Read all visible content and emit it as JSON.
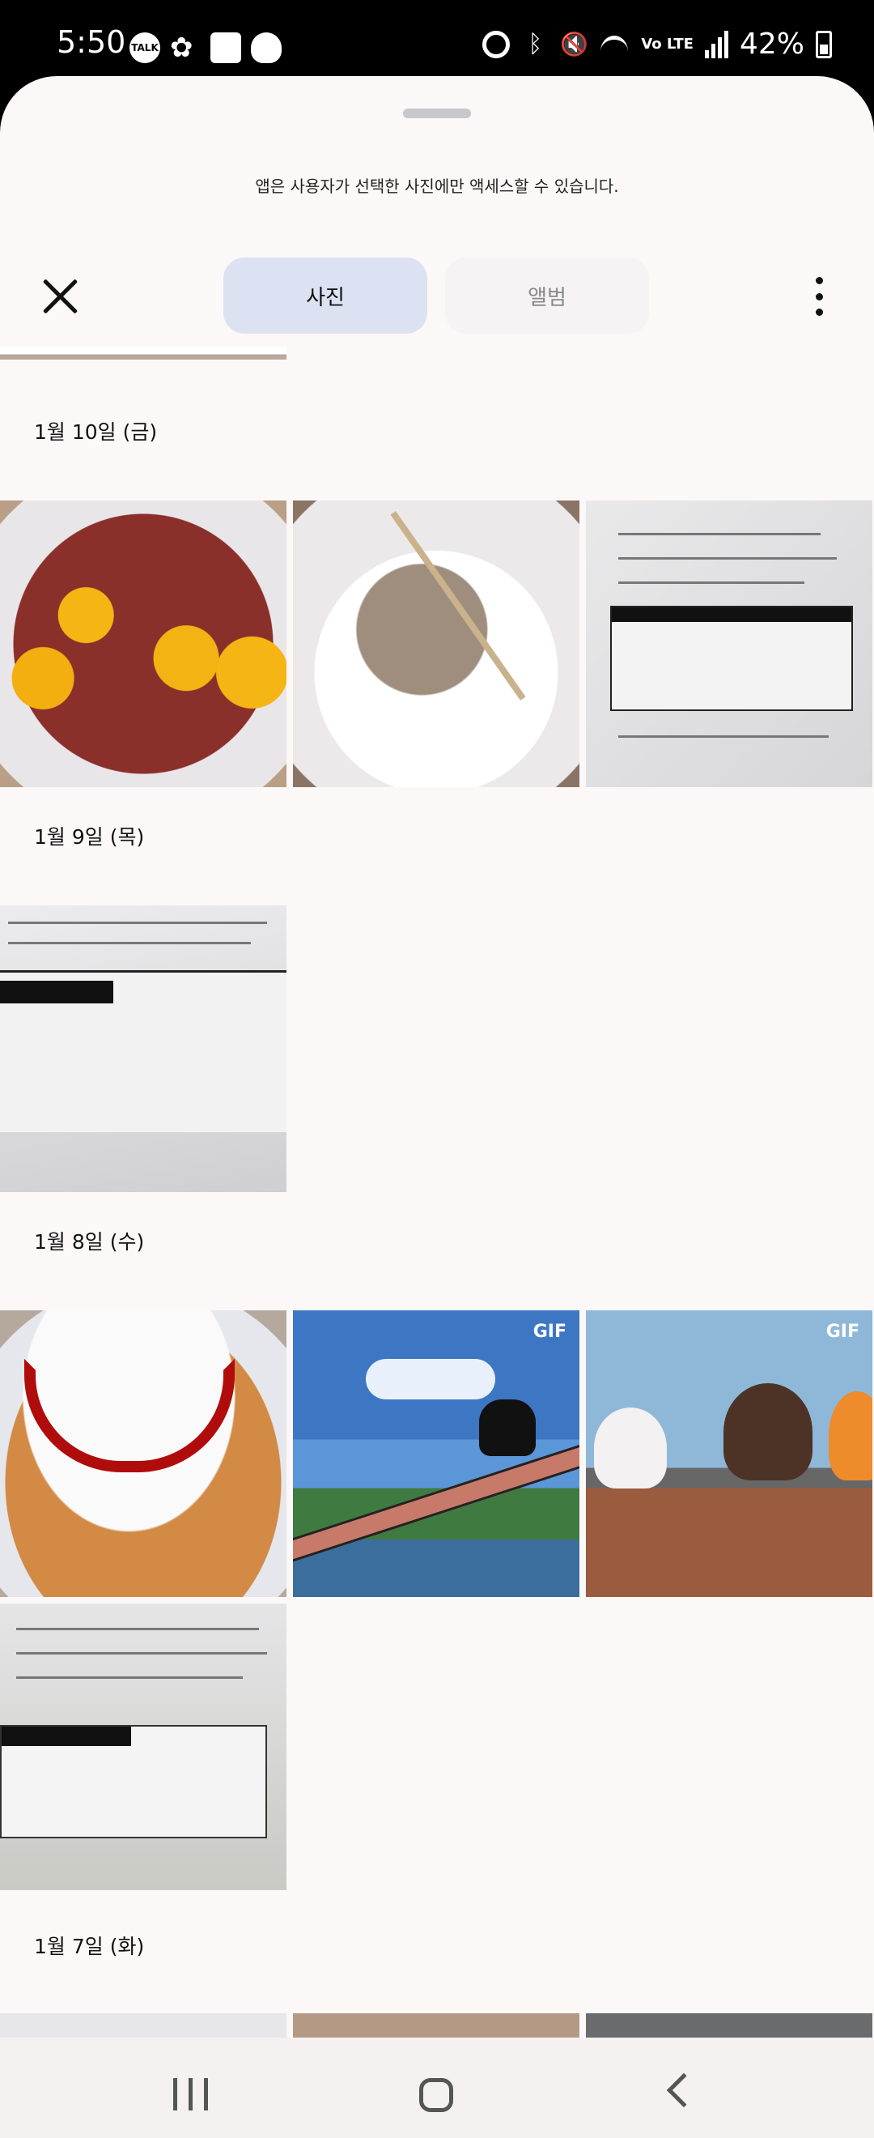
{
  "status_bar": {
    "time": "5:50",
    "left_icons": [
      "talk-icon",
      "clip-icon",
      "image-icon",
      "cloud-icon"
    ],
    "talk_text": "TALK",
    "right_icons": [
      "alarm-icon",
      "bluetooth-icon",
      "mute-icon",
      "wifi-icon",
      "lte-icon",
      "signal-icon"
    ],
    "lte_text": "Vo LTE",
    "battery": "42%"
  },
  "sheet": {
    "notice": "앱은 사용자가 선택한 사진에만 액세스할 수 있습니다.",
    "tabs": [
      {
        "label": "사진",
        "active": true
      },
      {
        "label": "앨범",
        "active": false
      }
    ]
  },
  "gallery": {
    "groups": [
      {
        "date": "1월 10일 (금)"
      },
      {
        "date": "1월 9일 (목)"
      },
      {
        "date": "1월 8일 (수)"
      },
      {
        "date": "1월 7일 (화)"
      }
    ],
    "gif_badge": "GIF"
  },
  "colors": {
    "sheet_bg": "#fcf8f8",
    "tab_active_bg": "#dce2f2",
    "status_bg": "#000000"
  }
}
